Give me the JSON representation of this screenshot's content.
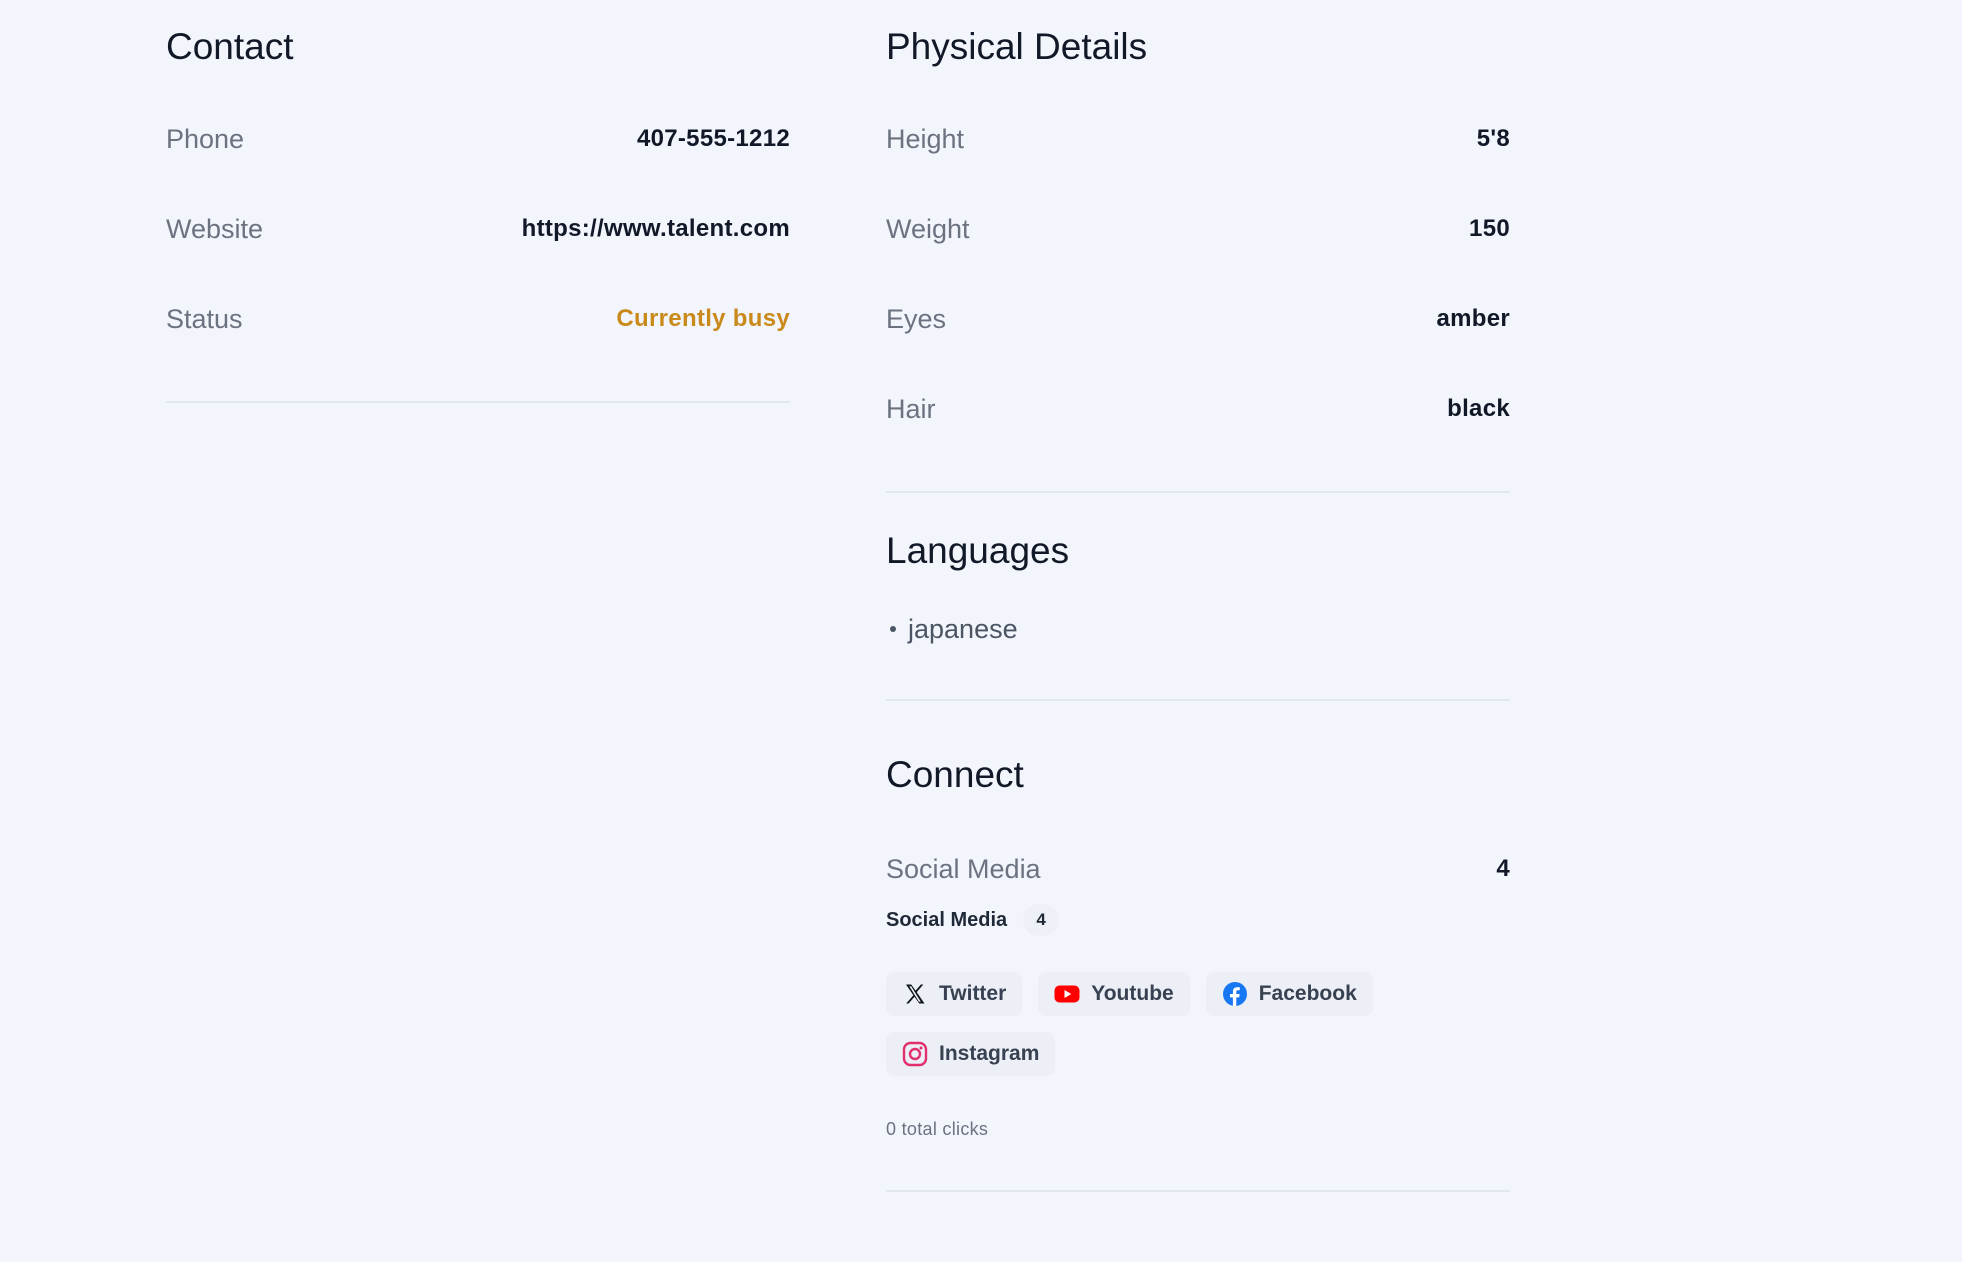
{
  "contact": {
    "title": "Contact",
    "rows": [
      {
        "label": "Phone",
        "value": "407-555-1212"
      },
      {
        "label": "Website",
        "value": "https://www.talent.com"
      },
      {
        "label": "Status",
        "value": "Currently busy"
      }
    ]
  },
  "physical": {
    "title": "Physical Details",
    "rows": [
      {
        "label": "Height",
        "value": "5'8"
      },
      {
        "label": "Weight",
        "value": "150"
      },
      {
        "label": "Eyes",
        "value": "amber"
      },
      {
        "label": "Hair",
        "value": "black"
      }
    ]
  },
  "languages": {
    "title": "Languages",
    "items": [
      "japanese"
    ]
  },
  "connect": {
    "title": "Connect",
    "summary_label": "Social Media",
    "summary_value": "4",
    "social_label": "Social Media",
    "social_count": "4",
    "links": [
      {
        "label": "Twitter",
        "icon": "x-twitter-icon"
      },
      {
        "label": "Youtube",
        "icon": "youtube-icon"
      },
      {
        "label": "Facebook",
        "icon": "facebook-icon"
      },
      {
        "label": "Instagram",
        "icon": "instagram-icon"
      }
    ],
    "clicks": "0 total clicks"
  },
  "colors": {
    "background": "#f3f5fc",
    "status_busy": "#c98a1b",
    "youtube": "#ff0000",
    "facebook": "#1877f2",
    "instagram": "#e1306c"
  }
}
